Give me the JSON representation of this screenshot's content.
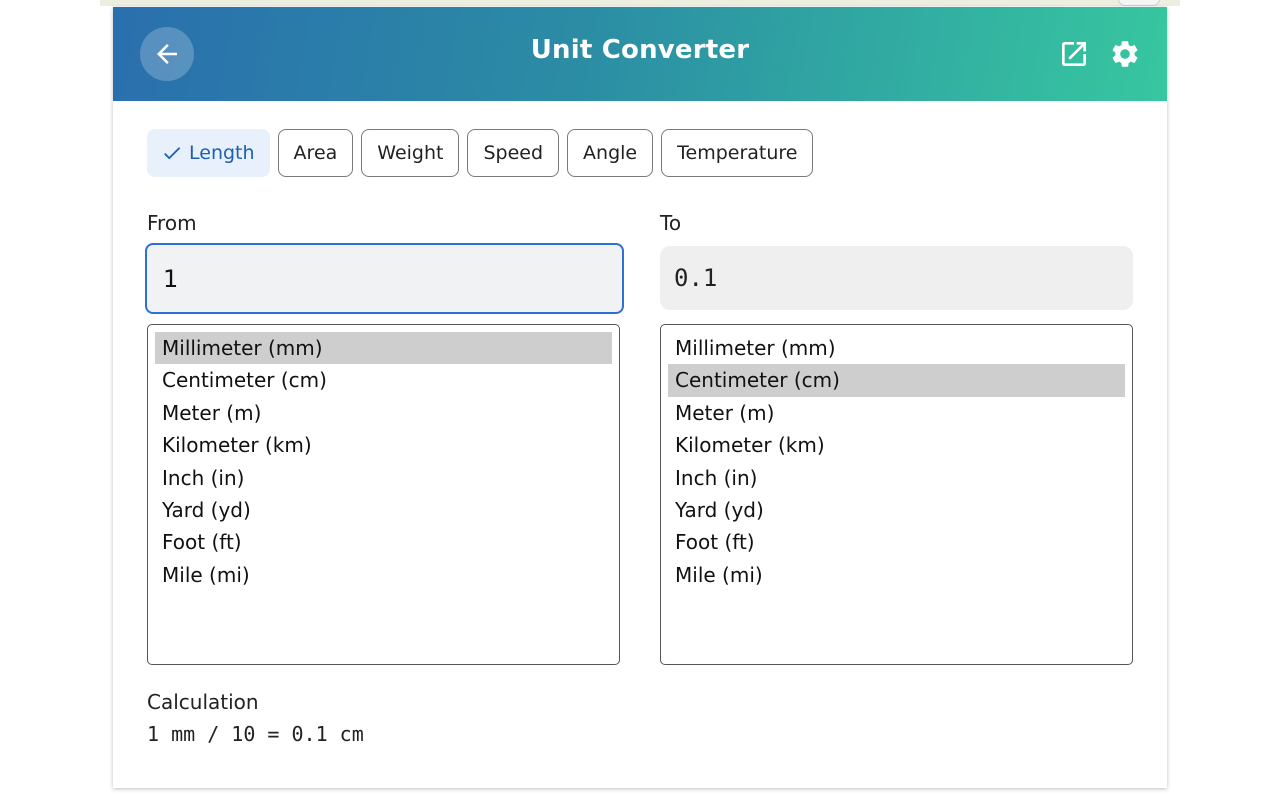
{
  "header": {
    "title": "Unit Converter",
    "back_icon": "arrow-left-icon",
    "external_icon": "external-link-icon",
    "settings_icon": "gear-icon"
  },
  "categories": [
    {
      "label": "Length",
      "selected": true
    },
    {
      "label": "Area",
      "selected": false
    },
    {
      "label": "Weight",
      "selected": false
    },
    {
      "label": "Speed",
      "selected": false
    },
    {
      "label": "Angle",
      "selected": false
    },
    {
      "label": "Temperature",
      "selected": false
    }
  ],
  "from": {
    "label": "From",
    "value": "1",
    "units": [
      "Millimeter (mm)",
      "Centimeter (cm)",
      "Meter (m)",
      "Kilometer (km)",
      "Inch (in)",
      "Yard (yd)",
      "Foot (ft)",
      "Mile (mi)"
    ],
    "selected_index": 0
  },
  "to": {
    "label": "To",
    "value": "0.1",
    "units": [
      "Millimeter (mm)",
      "Centimeter (cm)",
      "Meter (m)",
      "Kilometer (km)",
      "Inch (in)",
      "Yard (yd)",
      "Foot (ft)",
      "Mile (mi)"
    ],
    "selected_index": 1
  },
  "calculation": {
    "label": "Calculation",
    "text": "1 mm / 10 = 0.1 cm"
  },
  "colors": {
    "header_start": "#2a6fae",
    "header_end": "#37c7a0",
    "accent": "#2f6fd6",
    "chip_selected_bg": "#e7f0fb",
    "chip_selected_text": "#1e5fb4",
    "list_selected_bg": "#cecece"
  }
}
